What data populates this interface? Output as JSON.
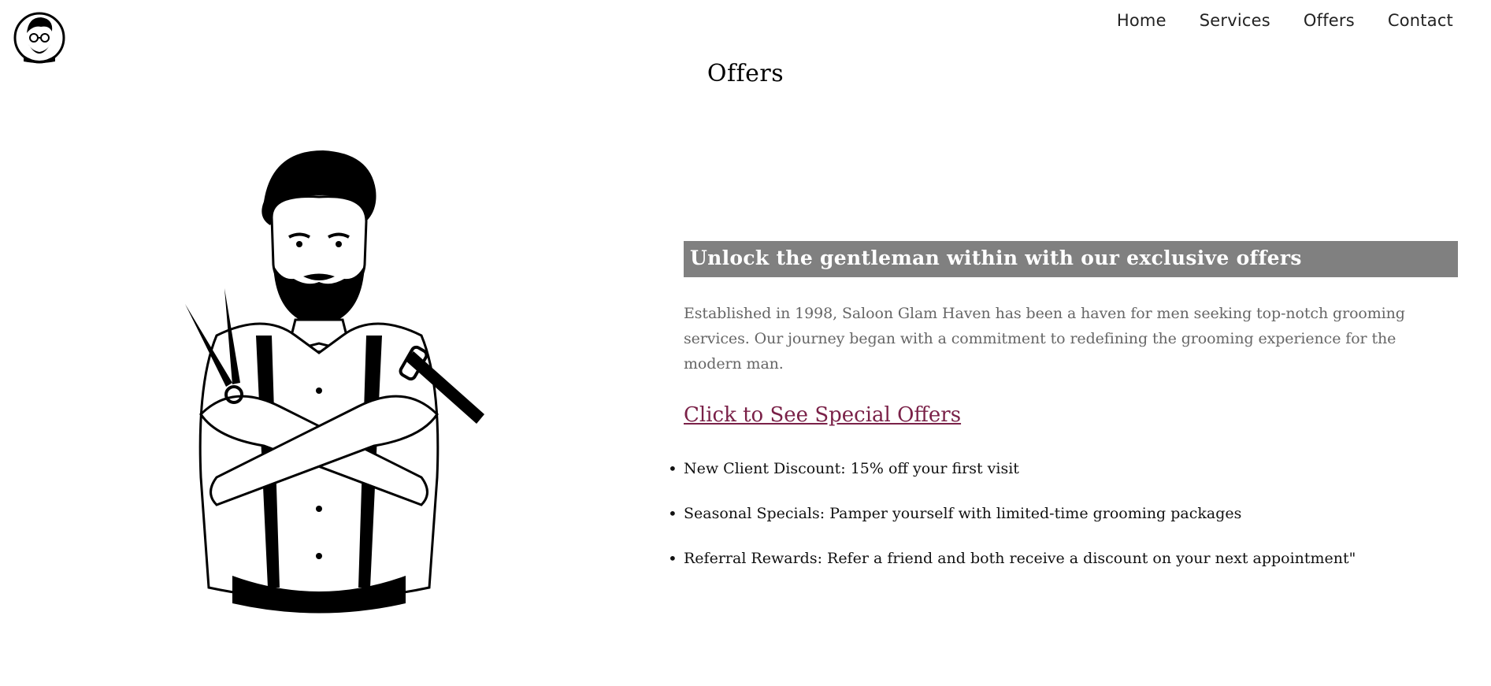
{
  "nav": {
    "items": [
      {
        "label": "Home"
      },
      {
        "label": "Services"
      },
      {
        "label": "Offers"
      },
      {
        "label": "Contact"
      }
    ]
  },
  "page": {
    "title": "Offers"
  },
  "offers_section": {
    "banner": "Unlock the gentleman within with our exclusive offers",
    "about": "Established in 1998, Saloon Glam Haven has been a haven for men seeking top-notch grooming services. Our journey began with a commitment to redefining the grooming experience for the modern man.",
    "cta_link": "Click to See Special Offers",
    "list": [
      {
        "text": "New Client Discount: 15% off your first visit"
      },
      {
        "text": "Seasonal Specials: Pamper yourself with limited-time grooming packages"
      },
      {
        "text": "Referral Rewards: Refer a friend and both receive a discount on your next appointment\""
      }
    ]
  },
  "colors": {
    "banner_bg": "#808080",
    "link": "#7a2148",
    "body_text": "#666666"
  },
  "icons": {
    "logo": "bearded-man-logo-icon",
    "illustration": "barber-holding-scissors-and-razor-illustration"
  }
}
